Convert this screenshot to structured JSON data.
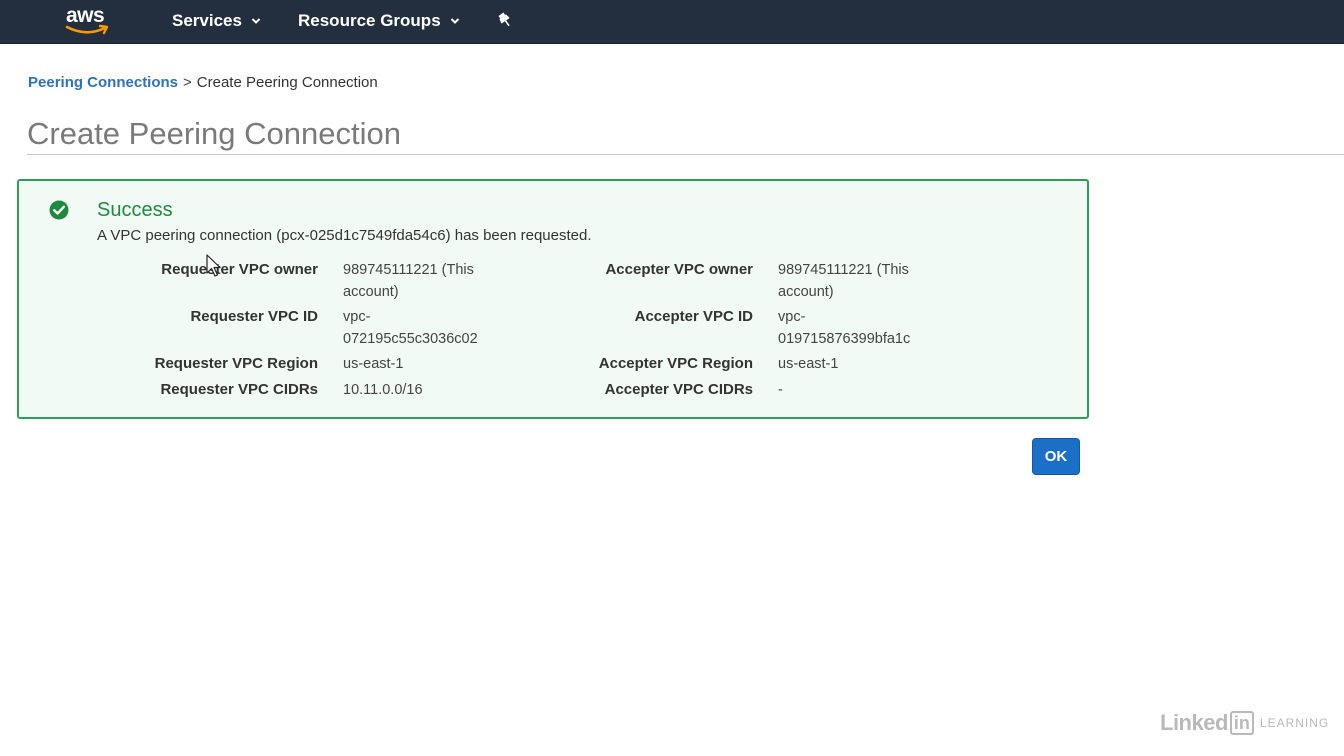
{
  "header": {
    "logo_text": "aws",
    "nav": {
      "services_label": "Services",
      "resource_groups_label": "Resource Groups"
    },
    "icons": [
      "chevron-down-icon",
      "pin-icon"
    ],
    "background_color": "#232f3e"
  },
  "breadcrumb": {
    "parent_label": "Peering Connections",
    "separator": ">",
    "current_label": "Create Peering Connection"
  },
  "page": {
    "title": "Create Peering Connection"
  },
  "success": {
    "icon": "check-circle-icon",
    "title": "Success",
    "message": "A VPC peering connection (pcx-025d1c7549fda54c6) has been requested.",
    "accent_color": "#1d8a3f",
    "requester": {
      "owner_label": "Requester VPC owner",
      "owner_value": "989745111221 (This account)",
      "id_label": "Requester VPC ID",
      "id_value": "vpc-072195c55c3036c02",
      "region_label": "Requester VPC Region",
      "region_value": "us-east-1",
      "cidrs_label": "Requester VPC CIDRs",
      "cidrs_value": "10.11.0.0/16"
    },
    "accepter": {
      "owner_label": "Accepter VPC owner",
      "owner_value": "989745111221 (This account)",
      "id_label": "Accepter VPC ID",
      "id_value": "vpc-019715876399bfa1c",
      "region_label": "Accepter VPC Region",
      "region_value": "us-east-1",
      "cidrs_label": "Accepter VPC CIDRs",
      "cidrs_value": "-"
    }
  },
  "actions": {
    "ok_label": "OK",
    "primary_color": "#1b6fc7"
  },
  "watermark": {
    "linked": "Linked",
    "in": "in",
    "learning": "LEARNING"
  }
}
